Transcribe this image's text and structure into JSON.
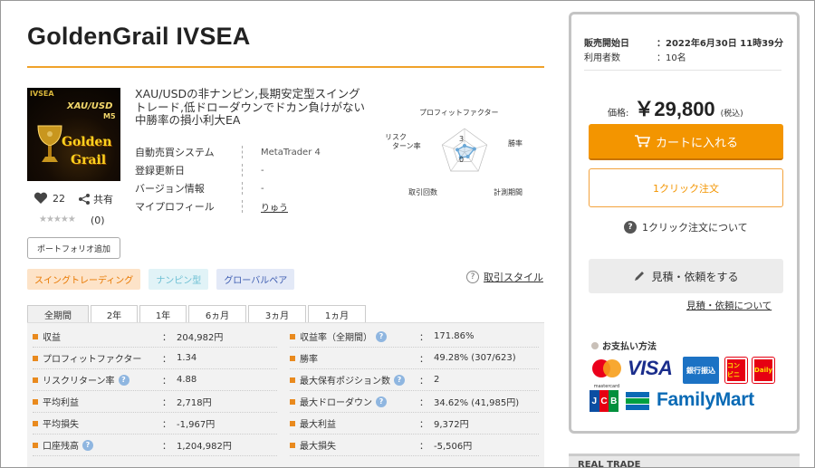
{
  "product": {
    "title": "GoldenGrail IVSEA",
    "image": {
      "brand": "IVSEA",
      "line1": "XAU/USD",
      "line2": "M5",
      "line3": "Golden",
      "line4": "Grail"
    },
    "description": "XAU/USDの非ナンピン,長期安定型スイングトレード,低ドローダウンでドカン負けがない中勝率の損小利大EA",
    "likes": "22",
    "share_label": "共有",
    "stars": "★★★★★",
    "review_count": "(0)",
    "portfolio_button": "ポートフォリオ追加"
  },
  "spec": [
    {
      "label": "自動売買システム",
      "value": "MetaTrader 4"
    },
    {
      "label": "登録更新日",
      "value": "-"
    },
    {
      "label": "バージョン情報",
      "value": "-"
    },
    {
      "label": "マイプロフィール",
      "value": "りゅう"
    }
  ],
  "radar": {
    "axes": [
      "プロフィットファクター",
      "勝率",
      "計測期間",
      "取引回数",
      "リスクリターン率"
    ],
    "axis_line1": [
      "プロフィットファクター",
      "勝率",
      "計測期間",
      "取引回数",
      "リスク"
    ],
    "axis_line2": [
      "",
      "",
      "",
      "",
      "ターン率"
    ],
    "scale_labels": [
      "3",
      "0"
    ],
    "max": 5,
    "values": [
      1.34,
      2.2,
      1.2,
      1.4,
      1.6
    ],
    "color": "#6aa7d6"
  },
  "tags": [
    "スイングトレーディング",
    "ナンピン型",
    "グローバルペア"
  ],
  "trade_style_link": "取引スタイル",
  "tabs": [
    "全期間",
    "2年",
    "1年",
    "6ヵ月",
    "3ヵ月",
    "1ヵ月"
  ],
  "stats_left": [
    {
      "label": "収益",
      "value": "204,982円",
      "help": false
    },
    {
      "label": "プロフィットファクター",
      "value": "1.34",
      "help": false
    },
    {
      "label": "リスクリターン率",
      "value": "4.88",
      "help": true
    },
    {
      "label": "平均利益",
      "value": "2,718円",
      "help": false
    },
    {
      "label": "平均損失",
      "value": "-1,967円",
      "help": false
    },
    {
      "label": "口座残高",
      "value": "1,204,982円",
      "help": true
    }
  ],
  "stats_right": [
    {
      "label": "収益率（全期間）",
      "value": "171.86%",
      "help": true
    },
    {
      "label": "勝率",
      "value": "49.28% (307/623)",
      "help": false
    },
    {
      "label": "最大保有ポジション数",
      "value": "2",
      "help": true
    },
    {
      "label": "最大ドローダウン",
      "value": "34.62% (41,985円)",
      "help": true
    },
    {
      "label": "最大利益",
      "value": "9,372円",
      "help": false
    },
    {
      "label": "最大損失",
      "value": "-5,506円",
      "help": false
    }
  ],
  "sidebar": {
    "sale_start_label": "販売開始日",
    "sale_start_value": "2022年6月30日 11時39分",
    "users_label": "利用者数",
    "users_value": "10名",
    "colon": "：",
    "price_label": "価格:",
    "price": "￥29,800",
    "tax": "(税込)",
    "cart_button": "カートに入れる",
    "oneclick_button": "1クリック注文",
    "oneclick_about": "1クリック注文について",
    "estimate_button": "見積・依頼をする",
    "estimate_about": "見積・依頼について",
    "payment_title": "お支払い方法",
    "payment_logos": {
      "mastercard": "mastercard",
      "visa": "VISA",
      "bank": "銀行振込",
      "conv1": "コンビニ",
      "conv2": "Daily",
      "jcb": "JCB",
      "familymart": "FamilyMart"
    }
  },
  "realtrade_header": "REAL TRADE",
  "colors": {
    "accent": "#f39500",
    "rule": "#f0a22a",
    "stat_marker": "#e98a1e",
    "help_blue": "#8fb6e0"
  }
}
